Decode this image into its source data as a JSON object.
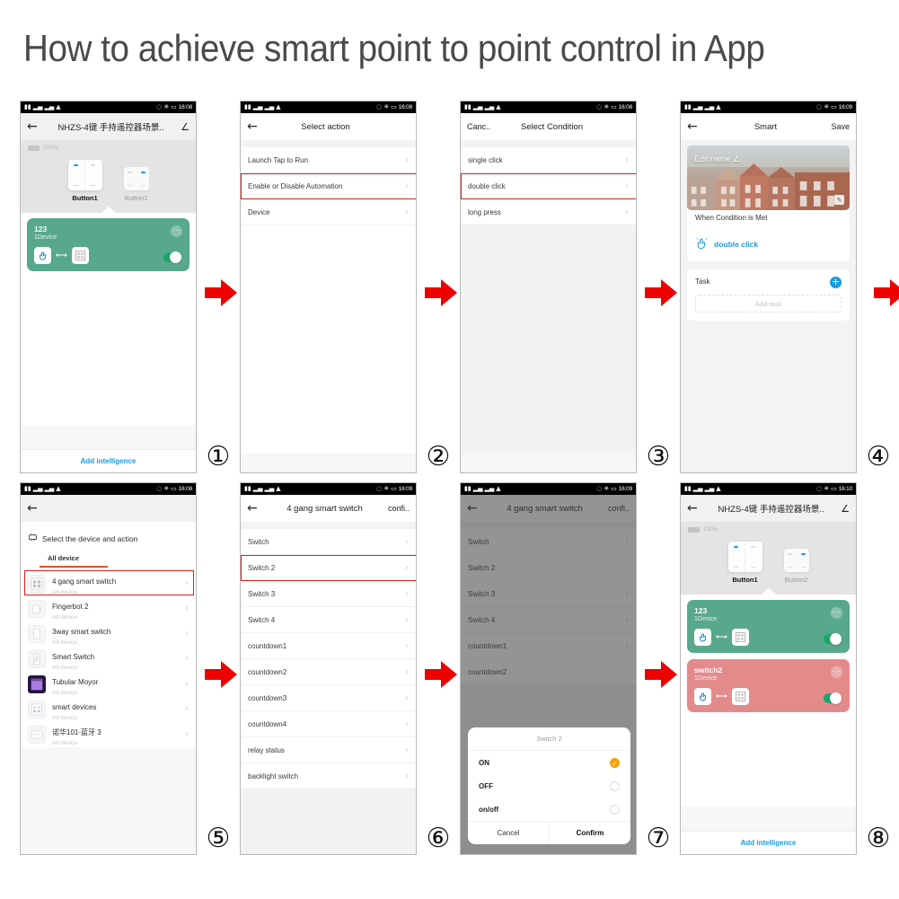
{
  "title": "How to achieve smart point to point control in App",
  "steps": [
    "①",
    "②",
    "③",
    "④",
    "⑤",
    "⑥",
    "⑦",
    "⑧"
  ],
  "colors": {
    "accent_red": "#e31b1b",
    "link_blue": "#1a9ae2",
    "scene_green": "#58a88d",
    "scene_red": "#e38b8b",
    "tab_orange": "#f04e23",
    "radio_orange": "#f5a201"
  },
  "status_bar": {
    "time_1": "16:08",
    "time_2": "16:08",
    "time_3": "16:08",
    "time_4": "16:09",
    "time_5": "16:08",
    "time_6": "16:09",
    "time_7": "16:09",
    "time_8": "16:10"
  },
  "screen1": {
    "nav_title": "NHZS-4键 手持遥控器场景..",
    "battery": "100%",
    "button1": "Button1",
    "button2": "Button2",
    "scene": {
      "name": "123",
      "sub": "1Device"
    },
    "add_label": "Add intelligence"
  },
  "screen2": {
    "nav_title": "Select action",
    "rows": [
      "Launch Tap to Run",
      "Enable or Disable Automation",
      "Device"
    ],
    "highlight_index": 1
  },
  "screen3": {
    "nav_left": "Canc..",
    "nav_title": "Select Condition",
    "rows": [
      "single click",
      "double click",
      "long press"
    ],
    "highlight_index": 1
  },
  "screen4": {
    "nav_title": "Smart",
    "nav_right": "Save",
    "hero_label": "Edit name ∠",
    "condition_title": "When Condition is Met",
    "condition_item": "double click",
    "task_title": "Task",
    "add_task": "Add task"
  },
  "screen5": {
    "section_title": "Select the device and action",
    "tab": "All device",
    "devices": [
      {
        "name": "4 gang smart switch",
        "sub": "All device",
        "icon": "four-dot-switch-icon"
      },
      {
        "name": "Fingerbot 2",
        "sub": "All device",
        "icon": "fingerbot-icon"
      },
      {
        "name": "3way smart switch",
        "sub": "All device",
        "icon": "wall-switch-icon"
      },
      {
        "name": "Smart Switch",
        "sub": "All device",
        "icon": "smart-switch-icon"
      },
      {
        "name": "Tubular Moyor",
        "sub": "All device",
        "icon": "tubular-motor-icon"
      },
      {
        "name": "smart devices",
        "sub": "All device",
        "icon": "breaker-icon"
      },
      {
        "name": "诺华101-蓝牙 3",
        "sub": "All device",
        "icon": "socket-icon"
      }
    ],
    "highlight_index": 0
  },
  "screen6": {
    "nav_title": "4 gang smart switch",
    "nav_right": "confi..",
    "rows": [
      "Switch",
      "Switch 2",
      "Switch 3",
      "Switch 4",
      "countdown1",
      "countdown2",
      "countdown3",
      "countdown4",
      "relay status",
      "backlight switch"
    ],
    "highlight_index": 1
  },
  "screen7": {
    "nav_title": "4 gang smart switch",
    "nav_right": "confi..",
    "rows": [
      "Switch",
      "Switch 2",
      "Switch 3",
      "Switch 4",
      "countdown1",
      "countdown2"
    ],
    "modal": {
      "title": "Switch 2",
      "options": [
        "ON",
        "OFF",
        "on/off"
      ],
      "selected_index": 0,
      "cancel": "Cancel",
      "confirm": "Confirm"
    }
  },
  "screen8": {
    "nav_title": "NHZS-4键 手持遥控器场景..",
    "battery": "100%",
    "button1": "Button1",
    "button2": "Button2",
    "scenes": [
      {
        "name": "123",
        "sub": "1Device",
        "color": "#58a88d"
      },
      {
        "name": "switch2",
        "sub": "1Device",
        "color": "#e38b8b"
      }
    ],
    "add_label": "Add intelligence"
  }
}
